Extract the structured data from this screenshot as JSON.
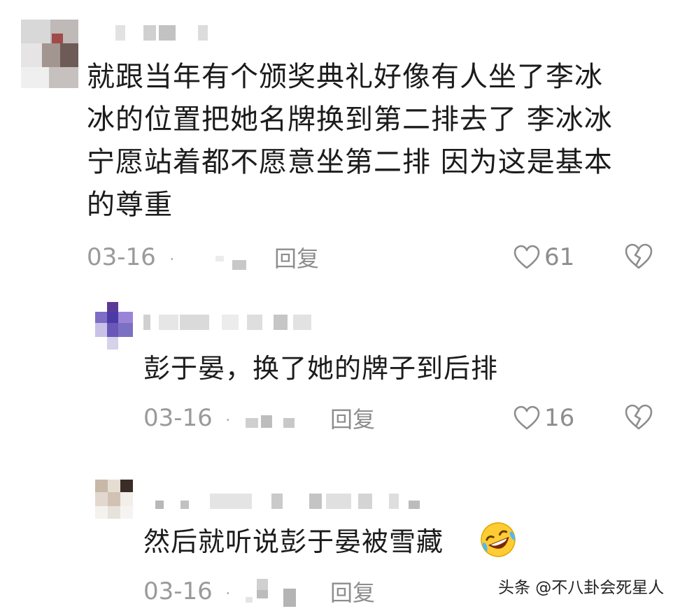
{
  "comments": [
    {
      "text_lines": [
        "就跟当年有个颁奖典礼好像有人坐了李冰",
        "冰的位置把她名牌换到第二排去了 李冰冰",
        "宁愿站着都不愿意坐第二排 因为这是基本",
        "的尊重"
      ],
      "date": "03-16",
      "dot": "·",
      "reply_label": "回复",
      "likes": "61"
    },
    {
      "text": "彭于晏，换了她的牌子到后排",
      "date": "03-16",
      "dot": "·",
      "reply_label": "回复",
      "likes": "16"
    },
    {
      "text": "然后就听说彭于晏被雪藏",
      "emoji": "rolling-on-floor-laughing",
      "date": "03-16",
      "dot": "·",
      "reply_label": "回复"
    }
  ],
  "watermark": "头条 @不八卦会死星人",
  "colors": {
    "text": "#1b1b1b",
    "meta": "#9a9a9a",
    "icon": "#8d8d8d",
    "background": "#ffffff"
  },
  "icons": [
    "heart-outline-icon",
    "broken-heart-icon",
    "laughing-emoji-icon"
  ]
}
